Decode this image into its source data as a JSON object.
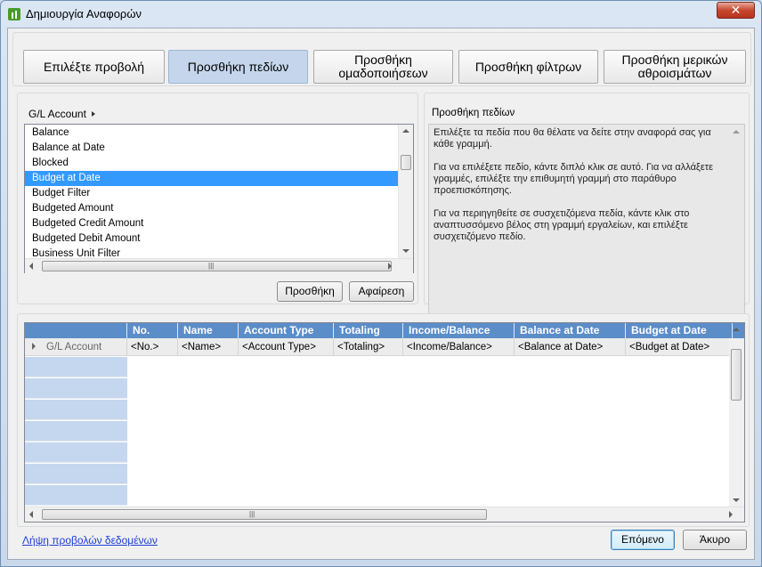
{
  "window": {
    "title": "Δημιουργία Αναφορών",
    "close_label": "✕"
  },
  "tabs": [
    {
      "label": "Επιλέξτε προβολή"
    },
    {
      "label": "Προσθήκη πεδίων"
    },
    {
      "label": "Προσθήκη ομαδοποιήσεων"
    },
    {
      "label": "Προσθήκη φίλτρων"
    },
    {
      "label": "Προσθήκη μερικών αθροισμάτων"
    }
  ],
  "fields_panel": {
    "table_name": "G/L Account",
    "items": [
      "Balance",
      "Balance at Date",
      "Blocked",
      "Budget at Date",
      "Budget Filter",
      "Budgeted Amount",
      "Budgeted Credit Amount",
      "Budgeted Debit Amount",
      "Business Unit Filter"
    ],
    "selected_item": "Budget at Date",
    "add_button": "Προσθήκη",
    "remove_button": "Αφαίρεση"
  },
  "info_panel": {
    "title": "Προσθήκη πεδίων",
    "paragraph1": "Επιλέξτε τα πεδία που θα θέλατε να δείτε στην αναφορά σας για κάθε γραμμή.",
    "paragraph2": "Για να επιλέξετε πεδίο, κάντε διπλό κλικ σε αυτό. Για να αλλάξετε γραμμές, επιλέξτε την επιθυμητή γραμμή στο παράθυρο προεπισκόπησης.",
    "paragraph3": "Για να περιηγηθείτε σε συσχετιζόμενα πεδία, κάντε κλικ στο αναπτυσσόμενο βέλος στη γραμμή εργαλείων, και επιλέξτε συσχετιζόμενο πεδίο."
  },
  "preview_grid": {
    "columns": [
      "No.",
      "Name",
      "Account Type",
      "Totaling",
      "Income/Balance",
      "Balance at Date",
      "Budget at Date"
    ],
    "row_label": "G/L Account",
    "row_values": [
      "<No.>",
      "<Name>",
      "<Account Type>",
      "<Totaling>",
      "<Income/Balance>",
      "<Balance at Date>",
      "<Budget at Date>"
    ]
  },
  "footer": {
    "link": "Λήψη προβολών δεδομένων",
    "next_button": "Επόμενο",
    "cancel_button": "Άκυρο"
  },
  "colors": {
    "accent": "#5b8dc9",
    "selection": "#3399ff",
    "active_tab": "#c5d6ec"
  }
}
